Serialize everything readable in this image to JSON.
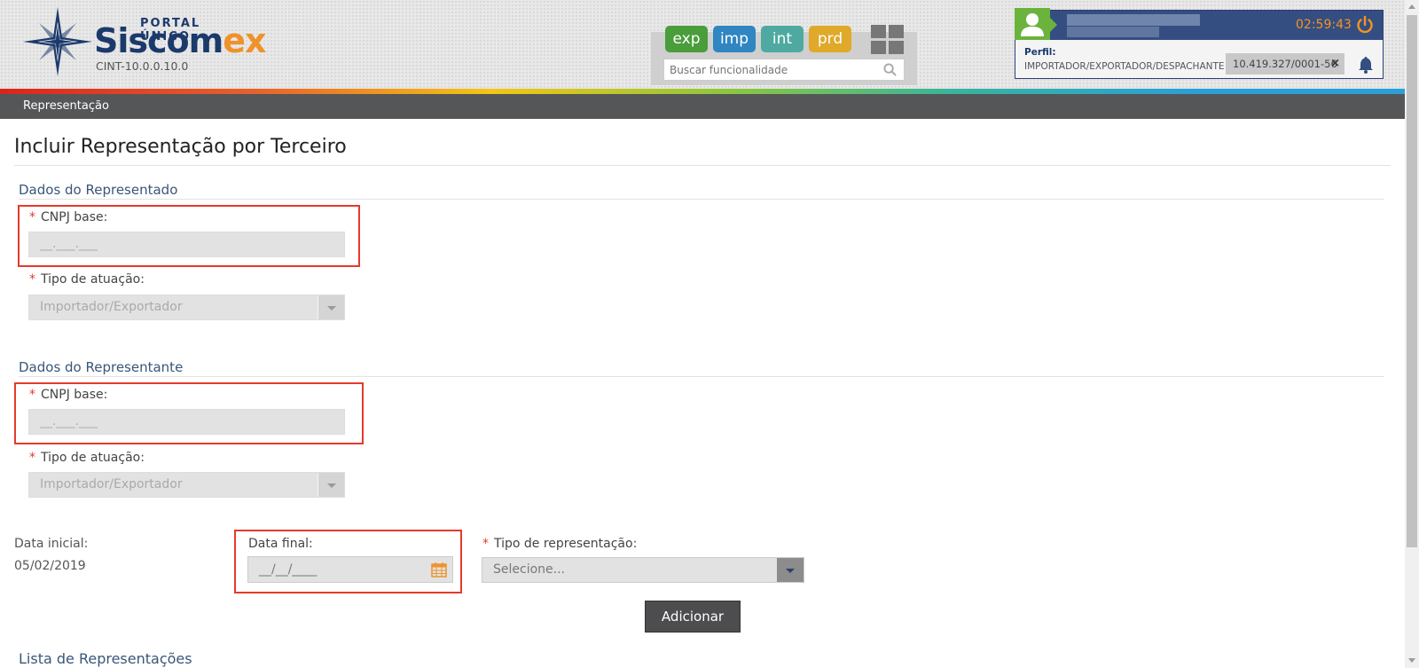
{
  "header": {
    "portal_label": "PORTAL ÚNICO",
    "brand_main": "Siscom",
    "brand_suffix": "ex",
    "version": "CINT-10.0.0.10.0",
    "apps": [
      {
        "label": "exp",
        "color": "#4a9d3b"
      },
      {
        "label": "imp",
        "color": "#2f86c0"
      },
      {
        "label": "int",
        "color": "#4eaaa0"
      },
      {
        "label": "prd",
        "color": "#e0a92a"
      }
    ],
    "search": {
      "placeholder": "Buscar funcionalidade"
    },
    "user": {
      "time": "02:59:43",
      "perfil_label": "Perfil:",
      "perfil_value": "IMPORTADOR/EXPORTADOR/DESPACHANTE",
      "cnpj_chip": "10.419.327/0001-56",
      "chip_close": "×"
    }
  },
  "menu": {
    "item": "Representação"
  },
  "page": {
    "title": "Incluir Representação por Terceiro"
  },
  "representado": {
    "section_title": "Dados do Representado",
    "cnpj_label": "CNPJ base:",
    "cnpj_placeholder": "__.___.___",
    "tipo_label": "Tipo de atuação:",
    "tipo_value": "Importador/Exportador"
  },
  "representante": {
    "section_title": "Dados do Representante",
    "cnpj_label": "CNPJ base:",
    "cnpj_placeholder": "__.___.___",
    "tipo_label": "Tipo de atuação:",
    "tipo_value": "Importador/Exportador"
  },
  "datas": {
    "inicial_label": "Data inicial:",
    "inicial_value": "05/02/2019",
    "final_label": "Data final:",
    "final_placeholder": "__/__/____"
  },
  "tipo_representacao": {
    "label": "Tipo de representação:",
    "value": "Selecione..."
  },
  "buttons": {
    "adicionar": "Adicionar"
  },
  "lista": {
    "title": "Lista de Representações"
  },
  "colors": {
    "accent": "#344e82",
    "required": "#e53a2b",
    "brand_orange": "#f0922b"
  }
}
